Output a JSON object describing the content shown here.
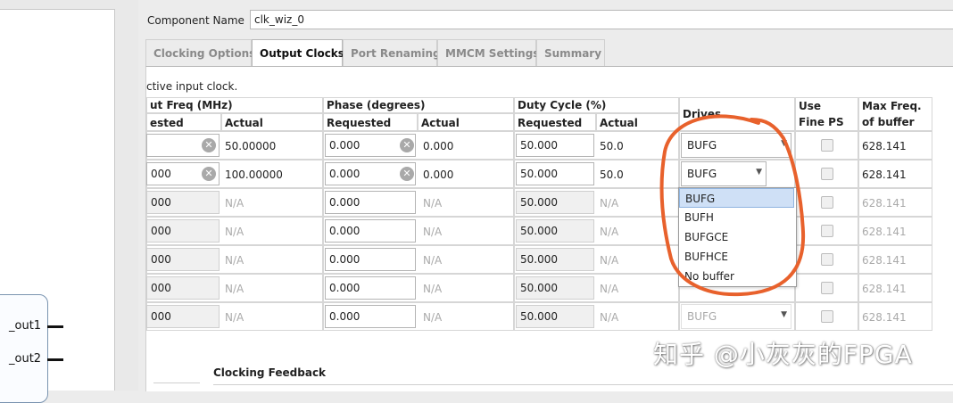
{
  "component": {
    "label": "Component Name",
    "value": "clk_wiz_0"
  },
  "tabs": [
    {
      "label": "Clocking Options",
      "active": false
    },
    {
      "label": "Output Clocks",
      "active": true
    },
    {
      "label": "Port Renaming",
      "active": false
    },
    {
      "label": "MMCM Settings",
      "active": false
    },
    {
      "label": "Summary",
      "active": false
    }
  ],
  "note": "ctive input clock.",
  "headers": {
    "out_freq": "ut Freq (MHz)",
    "phase": "Phase (degrees)",
    "duty": "Duty Cycle (%)",
    "drives": "Drives",
    "use_fine_ps": "Use",
    "use_fine_ps_2": "Fine PS",
    "max_freq": "Max Freq.",
    "max_freq_2": "of buffer",
    "requested_cut": "ested",
    "requested": "Requested",
    "actual": "Actual"
  },
  "rows": [
    {
      "freq_req": "",
      "freq_act": "50.00000",
      "phase_req": "0.000",
      "phase_act": "0.000",
      "duty_req": "50.000",
      "duty_act": "50.0",
      "drives": "BUFG",
      "max": "628.141",
      "enabled": true
    },
    {
      "freq_req": "000",
      "freq_act": "100.00000",
      "phase_req": "0.000",
      "phase_act": "0.000",
      "duty_req": "50.000",
      "duty_act": "50.0",
      "drives": "BUFG",
      "max": "628.141",
      "enabled": true
    },
    {
      "freq_req": "000",
      "freq_act": "N/A",
      "phase_req": "0.000",
      "phase_act": "N/A",
      "duty_req": "50.000",
      "duty_act": "N/A",
      "drives": "",
      "max": "628.141",
      "enabled": false
    },
    {
      "freq_req": "000",
      "freq_act": "N/A",
      "phase_req": "0.000",
      "phase_act": "N/A",
      "duty_req": "50.000",
      "duty_act": "N/A",
      "drives": "",
      "max": "628.141",
      "enabled": false
    },
    {
      "freq_req": "000",
      "freq_act": "N/A",
      "phase_req": "0.000",
      "phase_act": "N/A",
      "duty_req": "50.000",
      "duty_act": "N/A",
      "drives": "",
      "max": "628.141",
      "enabled": false
    },
    {
      "freq_req": "000",
      "freq_act": "N/A",
      "phase_req": "0.000",
      "phase_act": "N/A",
      "duty_req": "50.000",
      "duty_act": "N/A",
      "drives": "",
      "max": "628.141",
      "enabled": false
    },
    {
      "freq_req": "000",
      "freq_act": "N/A",
      "phase_req": "0.000",
      "phase_act": "N/A",
      "duty_req": "50.000",
      "duty_act": "N/A",
      "drives": "BUFG",
      "max": "628.141",
      "enabled": false
    }
  ],
  "dropdown_options": [
    "BUFG",
    "BUFH",
    "BUFGCE",
    "BUFHCE",
    "No buffer"
  ],
  "dropdown_selected": "BUFG",
  "feedback_title": "Clocking Feedback",
  "ports": [
    "_out1",
    "_out2"
  ],
  "watermark": "知乎 @小灰灰的FPGA",
  "colors": {
    "annotation": "#e8612c",
    "dropdown_highlight": "#cfe0f6"
  },
  "icons": {
    "clear": "clear-icon",
    "dropdown_arrow": "dropdown-arrow-icon"
  }
}
